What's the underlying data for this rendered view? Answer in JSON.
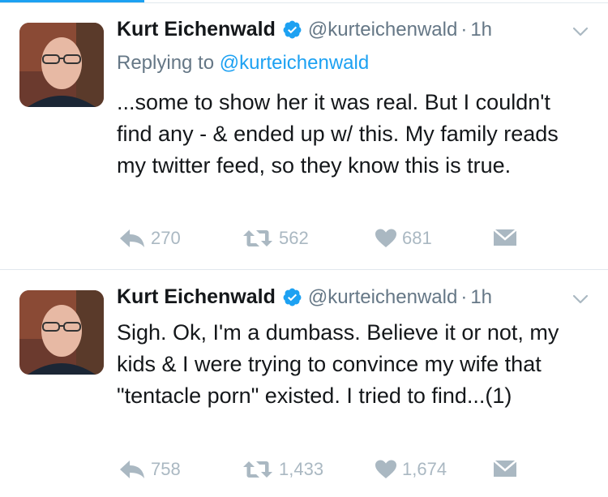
{
  "tweets": [
    {
      "author": {
        "name": "Kurt Eichenwald",
        "handle": "@kurteichenwald"
      },
      "separator": "·",
      "time": "1h",
      "replying_to": {
        "prefix": "Replying to",
        "handle": "@kurteichenwald"
      },
      "text": "...some to show her it was real. But I couldn't find any - & ended up w/ this. My family reads my twitter feed, so they know this is true.",
      "stats": {
        "replies": "270",
        "retweets": "562",
        "likes": "681"
      }
    },
    {
      "author": {
        "name": "Kurt Eichenwald",
        "handle": "@kurteichenwald"
      },
      "separator": "·",
      "time": "1h",
      "text": "Sigh. Ok, I'm a dumbass. Believe it or not, my kids & I were trying to convince my wife that \"tentacle porn\" existed. I tried to find...(1)",
      "stats": {
        "replies": "758",
        "retweets": "1,433",
        "likes": "1,674"
      }
    }
  ],
  "colors": {
    "accent": "#1da1f2",
    "muted": "#657786",
    "icon": "#aab8c2",
    "text": "#14171a"
  }
}
